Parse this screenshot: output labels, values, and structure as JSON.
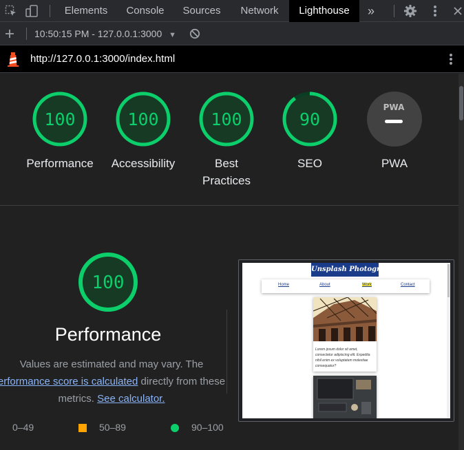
{
  "devtools": {
    "tabs": [
      "Elements",
      "Console",
      "Sources",
      "Network",
      "Lighthouse"
    ],
    "active_tab": "Lighthouse",
    "more_tabs_glyph": "»"
  },
  "toolbar": {
    "report_select": "10:50:15 PM - 127.0.0.1:3000"
  },
  "url_bar": {
    "url": "http://127.0.0.1:3000/index.html"
  },
  "gauges": [
    {
      "score": "100",
      "label": "Performance",
      "fraction": 1.0
    },
    {
      "score": "100",
      "label": "Accessibility",
      "fraction": 1.0
    },
    {
      "score": "100",
      "label": "Best Practices",
      "label_line1": "Best",
      "label_line2": "Practices",
      "fraction": 1.0
    },
    {
      "score": "90",
      "label": "SEO",
      "fraction": 0.9
    },
    {
      "score": "PWA",
      "label": "PWA"
    }
  ],
  "performance": {
    "score": "100",
    "title": "Performance",
    "desc_line1": "Values are estimated and may vary. The",
    "desc_link1": "erformance score is calculated",
    "desc_after_link1": " directly from these",
    "desc_line3_prefix": "metrics. ",
    "desc_link2": "See calculator."
  },
  "legend": {
    "fail": "0–49",
    "average": "50–89",
    "pass": "90–100"
  },
  "thumbnail": {
    "logo": "Unsplash Photography",
    "nav": [
      "Home",
      "About",
      "Work",
      "Contact"
    ],
    "card_text": "Lorem ipsum dolor sit amet, consectetur adipiscing elit. Expedita nihil enim ex voluptatem molestiae consequatur?"
  },
  "colors": {
    "pass": "#0cce6b",
    "pass_text": "#0cce6b",
    "average": "#ffa400",
    "fail": "#ff4e42",
    "gauge_track": "#0b3d24"
  }
}
